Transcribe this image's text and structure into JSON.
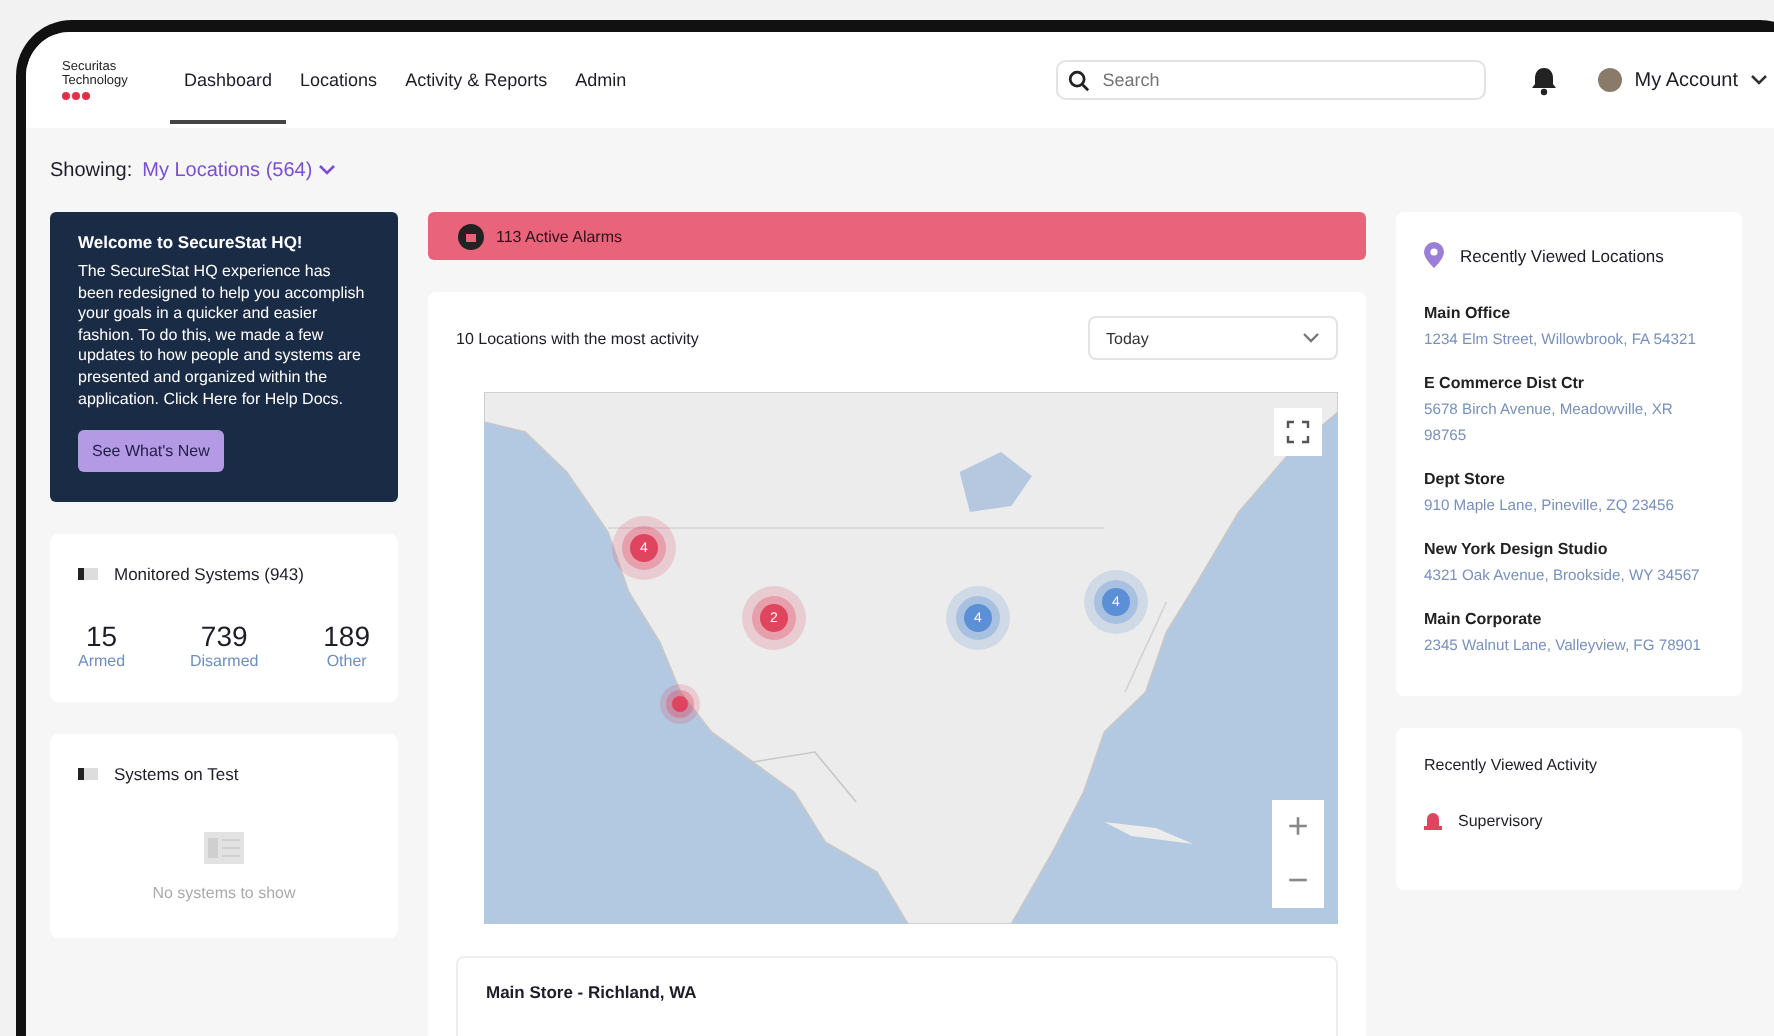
{
  "logo": {
    "line1": "Securitas",
    "line2": "Technology"
  },
  "nav": [
    {
      "label": "Dashboard",
      "selected": true
    },
    {
      "label": "Locations",
      "selected": false
    },
    {
      "label": "Activity & Reports",
      "selected": false
    },
    {
      "label": "Admin",
      "selected": false
    }
  ],
  "search": {
    "placeholder": "Search"
  },
  "account": {
    "label": "My Account"
  },
  "showing": {
    "label": "Showing:",
    "value": "My Locations (564)"
  },
  "welcome": {
    "title": "Welcome to SecureStat HQ!",
    "body": "The SecureStat HQ experience has been redesigned to help you accomplish your goals in a quicker and easier fashion. To do this, we made a few updates to how people and systems are presented and organized within the application. Click Here for Help Docs.",
    "button": "See What's New"
  },
  "monitored": {
    "title": "Monitored Systems (943)",
    "stats": [
      {
        "value": "15",
        "label": "Armed"
      },
      {
        "value": "739",
        "label": "Disarmed"
      },
      {
        "value": "189",
        "label": "Other"
      }
    ]
  },
  "systems_on_test": {
    "title": "Systems on Test",
    "empty": "No systems to show"
  },
  "alarm_bar": {
    "label": "113 Active Alarms"
  },
  "activity": {
    "title": "10 Locations with the most activity",
    "period": "Today",
    "markers": [
      {
        "count": "4",
        "color": "#e0455f"
      },
      {
        "count": "2",
        "color": "#e0455f"
      },
      {
        "count": "4",
        "color": "#5b8fd6"
      },
      {
        "count": "4",
        "color": "#5b8fd6"
      },
      {
        "color": "#e0455f"
      }
    ],
    "zoom_in": "+",
    "zoom_out": "−"
  },
  "location_card": {
    "title": "Main Store - Richland, WA"
  },
  "recent_locations": {
    "title": "Recently Viewed Locations",
    "items": [
      {
        "name": "Main Office",
        "address": "1234 Elm Street, Willowbrook, FA 54321"
      },
      {
        "name": "E Commerce Dist Ctr",
        "address": "5678 Birch Avenue, Meadowville, XR 98765"
      },
      {
        "name": "Dept Store",
        "address": "910 Maple Lane, Pineville, ZQ 23456"
      },
      {
        "name": "New York Design Studio",
        "address": "4321 Oak Avenue, Brookside, WY 34567"
      },
      {
        "name": "Main Corporate",
        "address": "2345 Walnut Lane, Valleyview, FG 78901"
      }
    ]
  },
  "recent_activity": {
    "title": "Recently Viewed Activity",
    "items": [
      {
        "label": "Supervisory"
      }
    ]
  }
}
